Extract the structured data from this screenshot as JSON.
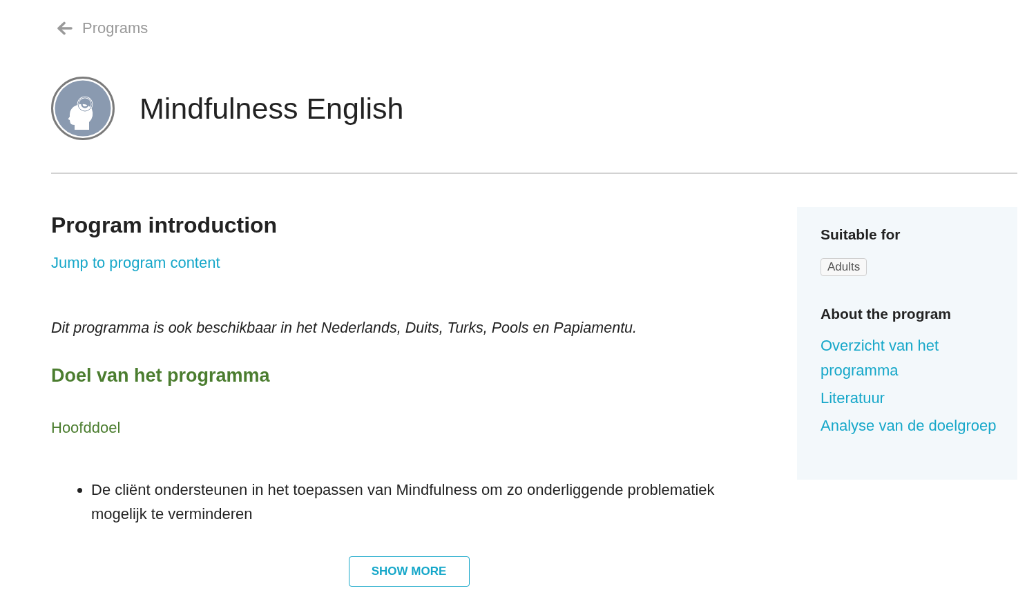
{
  "back_link": {
    "label": "Programs"
  },
  "header": {
    "title": "Mindfulness English"
  },
  "introduction": {
    "heading": "Program introduction",
    "jump_link": "Jump to program content",
    "note": "Dit programma is ook beschikbaar in het Nederlands, Duits, Turks, Pools en Papiamentu.",
    "section_heading": "Doel van het programma",
    "subheading": "Hoofddoel",
    "bullets": [
      "De cliënt ondersteunen in het toepassen van Mindfulness om zo onderliggende problematiek mogelijk te verminderen"
    ],
    "show_more_button": "SHOW MORE"
  },
  "sidebar": {
    "sections": [
      {
        "heading": "Suitable for",
        "kind": "tags",
        "items": [
          "Adults"
        ]
      },
      {
        "heading": "About the program",
        "kind": "links",
        "items": [
          "Overzicht van het programma",
          "Literatuur",
          "Analyse van de doelgroep"
        ]
      }
    ]
  }
}
